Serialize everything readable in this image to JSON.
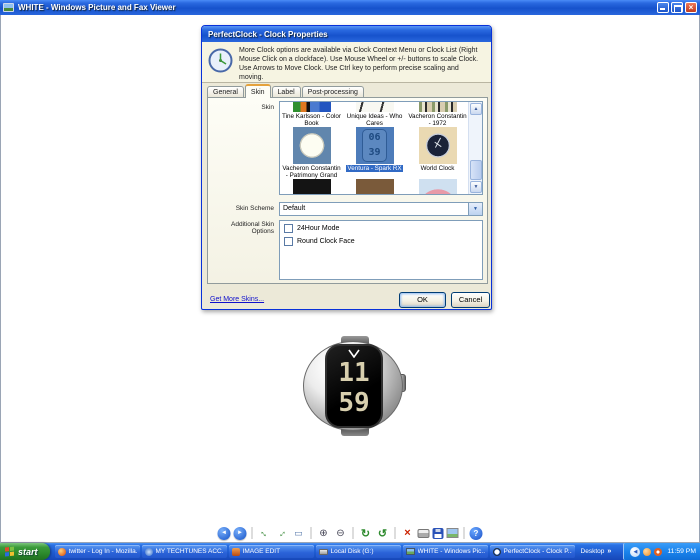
{
  "window": {
    "title": "WHITE - Windows Picture and Fax Viewer"
  },
  "dialog": {
    "title": "PerfectClock - Clock Properties",
    "info_text": "More Clock options are available via Clock Context Menu or Clock List (Right Mouse Click on a clockface). Use Mouse Wheel or +/- buttons to scale Clock. Use Arrows to Move Clock. Use Ctrl key to perform precise scaling and moving.",
    "tabs": [
      {
        "label": "General",
        "active": false
      },
      {
        "label": "Skin",
        "active": true
      },
      {
        "label": "Label",
        "active": false
      },
      {
        "label": "Post-processing",
        "active": false
      }
    ],
    "skin_list_label": "Skin",
    "skins_row1": [
      {
        "label": "Tine Karlsson - Color Book"
      },
      {
        "label": "Unique Ideas - Who Cares"
      },
      {
        "label": "Vacheron Constantin - 1972"
      }
    ],
    "skins_row2": [
      {
        "label": "Vacheron Constantin - Patrimony Grand",
        "selected": false
      },
      {
        "label": "Ventura - Spark RX",
        "selected": true,
        "thumb_digits": "06\n39"
      },
      {
        "label": "World Clock",
        "selected": false
      }
    ],
    "skin_scheme_label": "Skin Scheme",
    "skin_scheme_value": "Default",
    "additional_options_label": "Additional Skin Options",
    "options": [
      {
        "label": "24Hour Mode",
        "checked": false
      },
      {
        "label": "Round Clock Face",
        "checked": false
      }
    ],
    "get_more_skins_link": "Get More Skins...",
    "ok_label": "OK",
    "cancel_label": "Cancel"
  },
  "clock_widget": {
    "hours": "11",
    "minutes": "59"
  },
  "viewer_toolbar": {
    "icons": [
      {
        "name": "previous-image-icon",
        "glyph": "◄",
        "style": "circle-blue"
      },
      {
        "name": "next-image-icon",
        "glyph": "►",
        "style": "circle-blue"
      },
      {
        "name": "separator"
      },
      {
        "name": "best-fit-icon",
        "glyph": "↔",
        "style": "diag-a"
      },
      {
        "name": "actual-size-icon",
        "glyph": "↔",
        "style": "diag-b"
      },
      {
        "name": "slideshow-icon",
        "glyph": "▭",
        "style": "plain-blue"
      },
      {
        "name": "separator"
      },
      {
        "name": "zoom-in-icon",
        "glyph": "⊕",
        "style": "plain-dark"
      },
      {
        "name": "zoom-out-icon",
        "glyph": "⊖",
        "style": "plain-dark"
      },
      {
        "name": "separator"
      },
      {
        "name": "rotate-clockwise-icon",
        "glyph": "↻",
        "style": "plain-green"
      },
      {
        "name": "rotate-counterclockwise-icon",
        "glyph": "↺",
        "style": "plain-green"
      },
      {
        "name": "separator"
      },
      {
        "name": "delete-icon",
        "glyph": "×",
        "style": "plain-red"
      },
      {
        "name": "print-icon",
        "glyph": "",
        "style": "printer"
      },
      {
        "name": "save-icon",
        "glyph": "",
        "style": "floppy"
      },
      {
        "name": "edit-image-icon",
        "glyph": "",
        "style": "picture"
      },
      {
        "name": "separator"
      },
      {
        "name": "help-icon",
        "glyph": "?",
        "style": "circle-help"
      }
    ]
  },
  "taskbar": {
    "start_label": "start",
    "buttons": [
      {
        "icon": "firefox-icon",
        "label": "twitter - Log In - Mozilla..."
      },
      {
        "icon": "ie-icon",
        "label": "MY TECHTUNES ACC..."
      },
      {
        "icon": "image-editor-icon",
        "label": "IMAGE EDIT"
      },
      {
        "icon": "drive-icon",
        "label": "Local Disk (G:)"
      },
      {
        "icon": "picture-icon",
        "label": "WHITE - Windows Pic..."
      },
      {
        "icon": "clock-icon",
        "label": "PerfectClock - Clock P..."
      }
    ],
    "desktop_toolbar_label": "Desktop",
    "tray_time": "11:59 PM"
  },
  "colors": {
    "titlebar_blue": "#1652cc",
    "selection_blue": "#316ac5",
    "dialog_bg": "#ece9d8",
    "taskbar_blue": "#1e5bd0",
    "start_green": "#2d8a2d"
  }
}
